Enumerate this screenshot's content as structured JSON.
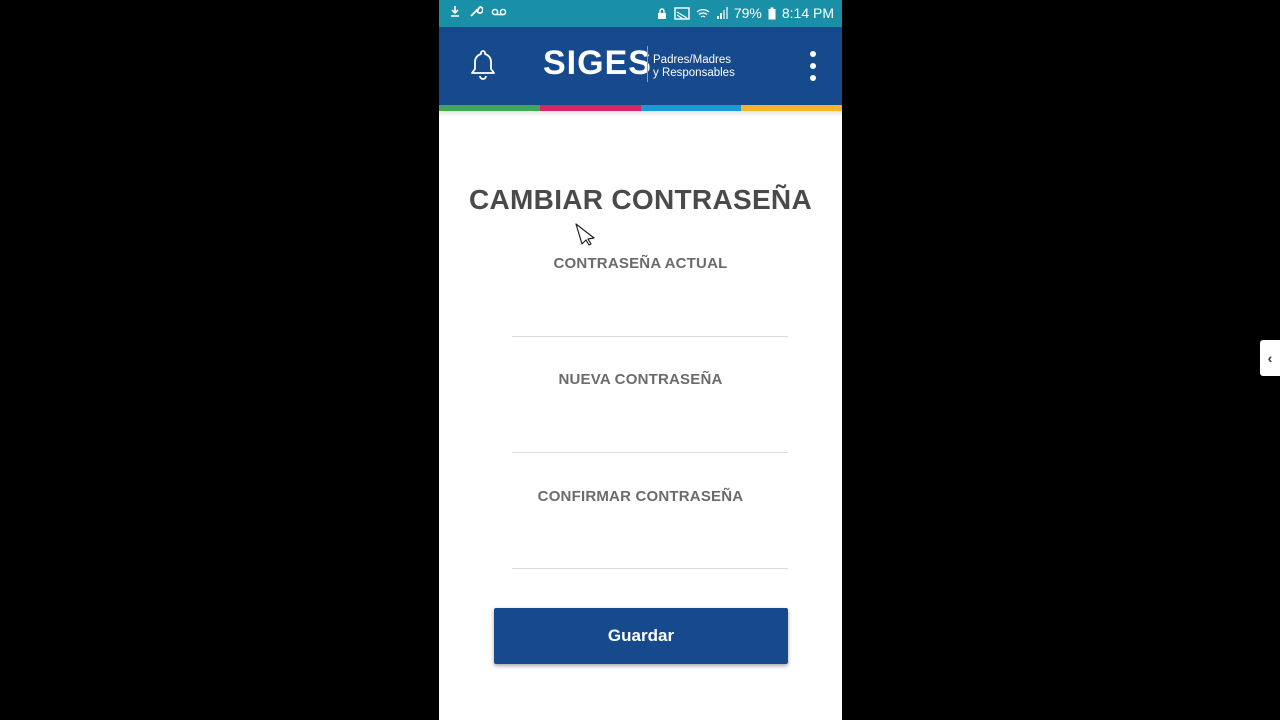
{
  "status_bar": {
    "battery": "79%",
    "time": "8:14 PM"
  },
  "header": {
    "brand": "SIGES",
    "subtitle_line1": "Padres/Madres",
    "subtitle_line2": "y Responsables",
    "stripe_colors": [
      "#3fa858",
      "#d6266b",
      "#1a9ad6",
      "#f2b52c"
    ],
    "accent": "#174a8c"
  },
  "form": {
    "title": "CAMBIAR CONTRASEÑA",
    "current_label": "CONTRASEÑA ACTUAL",
    "current_value": "",
    "new_label": "NUEVA CONTRASEÑA",
    "new_value": "",
    "confirm_label": "CONFIRMAR CONTRASEÑA",
    "confirm_value": "",
    "save_label": "Guardar"
  },
  "icons": {
    "notifications": "bell-icon",
    "menu": "more-vert-icon",
    "side_panel": "chevron-left-icon"
  },
  "side_tab": {
    "glyph": "‹"
  }
}
